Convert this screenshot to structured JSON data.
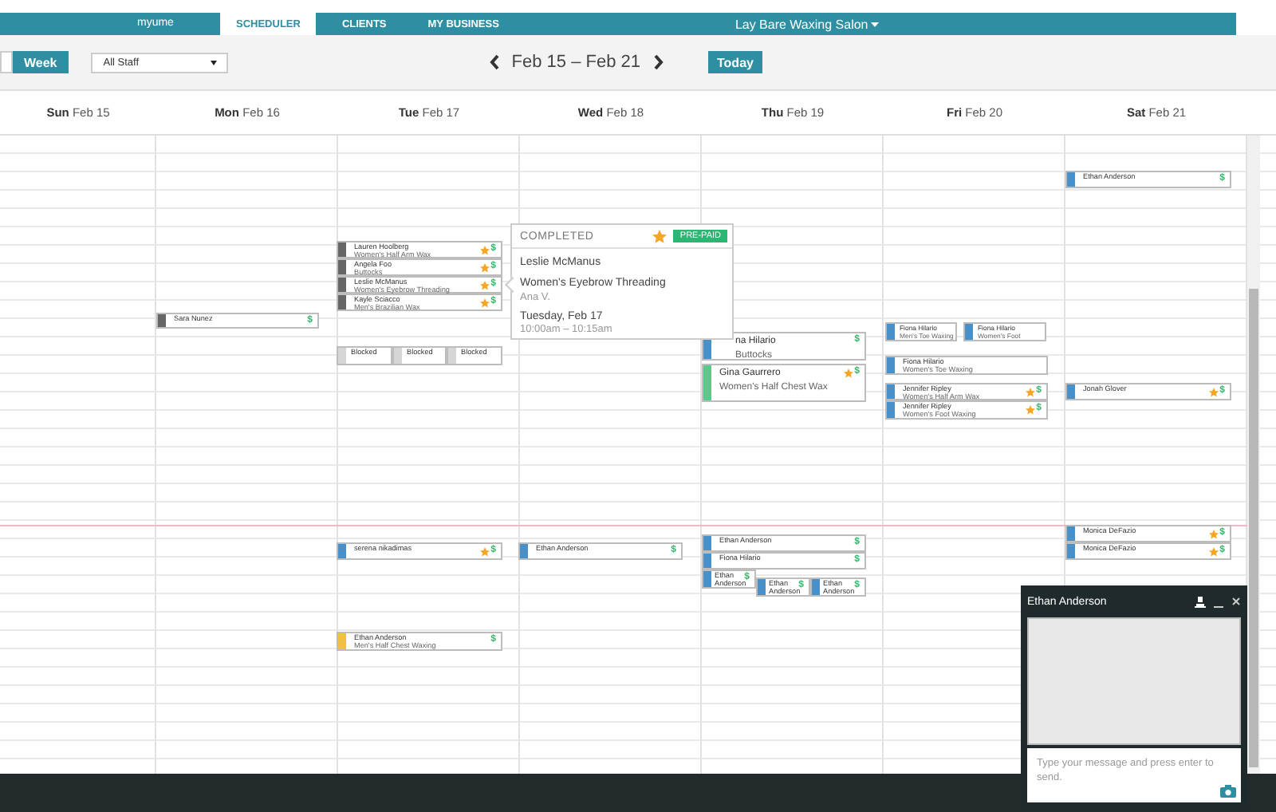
{
  "top_bar": {
    "logo": "myume",
    "tabs": [
      {
        "label": "SCHEDULER",
        "selected": true
      },
      {
        "label": "CLIENTS",
        "selected": false
      },
      {
        "label": "MY BUSINESS",
        "selected": false
      }
    ],
    "salon": "Lay Bare Waxing Salon"
  },
  "toolbar": {
    "view_button": "Week",
    "staff_select": "All Staff",
    "date_range": "Feb 15 – Feb 21",
    "today_button": "Today"
  },
  "days": [
    {
      "header": "**Sun** Feb 15"
    },
    {
      "header": "**Mon** Feb 16",
      "appointments": [
        {
          "kind": "appointment",
          "client": "Sara Nunez",
          "color": "#666666",
          "starred": false,
          "badge": "$"
        }
      ]
    },
    {
      "header": "**Tue** Feb 17",
      "appointments": [
        {
          "kind": "appointment",
          "client": "Lauren Hoolberg",
          "service": "Women's Half Arm Wax",
          "color": "#666666",
          "starred": true,
          "badge": "$"
        },
        {
          "kind": "appointment",
          "client": "Angela Foo",
          "service": "Buttocks",
          "color": "#666666",
          "starred": true,
          "badge": "$"
        },
        {
          "kind": "appointment",
          "client": "Leslie McManus",
          "service": "Women's Eyebrow Threading",
          "color": "#666666",
          "starred": true,
          "badge": "$"
        },
        {
          "kind": "appointment",
          "client": "Kayle Sciacco",
          "service": "Men's Brazilian Wax",
          "color": "#666666",
          "starred": true,
          "badge": "$"
        },
        {
          "kind": "blocked",
          "client": "Blocked"
        },
        {
          "kind": "blocked",
          "client": "Blocked"
        },
        {
          "kind": "blocked",
          "client": "Blocked"
        },
        {
          "kind": "appointment",
          "client": "serena nikadimas",
          "color": "#4a90c8",
          "starred": true,
          "badge": "$"
        },
        {
          "kind": "appointment",
          "client": "Ethan Anderson",
          "service": "Men's Half Chest Waxing",
          "color": "#f0c040",
          "starred": false,
          "badge": "$"
        }
      ]
    },
    {
      "header": "**Wed** Feb 18",
      "appointments": [
        {
          "kind": "appointment",
          "client": "Ethan Anderson",
          "color": "#4a90c8",
          "starred": false,
          "badge": "$"
        }
      ]
    },
    {
      "header": "**Thu** Feb 19",
      "appointments": [
        {
          "kind": "appointment",
          "client": "na Hilario",
          "service": "Buttocks",
          "color": "#4a90c8",
          "starred": false,
          "badge": "$"
        },
        {
          "kind": "appointment",
          "client": "Gina Gaurrero",
          "service": "Women's Half Chest Wax",
          "color": "#5bc98a",
          "starred": true,
          "badge": "$"
        },
        {
          "kind": "appointment",
          "client": "Ethan Anderson",
          "color": "#4a90c8",
          "starred": false,
          "badge": "$"
        },
        {
          "kind": "appointment",
          "client": "Fiona Hilario",
          "color": "#4a90c8",
          "starred": false,
          "badge": "$"
        },
        {
          "kind": "appointment",
          "client": "Ethan Anderson",
          "color": "#4a90c8",
          "starred": false,
          "badge": "$"
        },
        {
          "kind": "appointment",
          "client": "Ethan Anderson",
          "color": "#4a90c8",
          "starred": false,
          "badge": "$"
        },
        {
          "kind": "appointment",
          "client": "Ethan Anderson",
          "color": "#4a90c8",
          "starred": false,
          "badge": "$"
        }
      ]
    },
    {
      "header": "**Fri** Feb 20",
      "appointments": [
        {
          "kind": "appointment",
          "client": "Fiona Hilario",
          "service": "Men's Toe Waxing",
          "color": "#4a90c8",
          "starred": false
        },
        {
          "kind": "appointment",
          "client": "Fiona Hilario",
          "service": "Women's Foot",
          "color": "#4a90c8",
          "starred": false
        },
        {
          "kind": "appointment",
          "client": "Fiona Hilario",
          "service": "Women's Toe Waxing",
          "color": "#4a90c8",
          "starred": false
        },
        {
          "kind": "appointment",
          "client": "Jennifer Ripley",
          "service": "Women's Half Arm Wax",
          "color": "#4a90c8",
          "starred": true,
          "badge": "$"
        },
        {
          "kind": "appointment",
          "client": "Jennifer Ripley",
          "service": "Women's Foot Waxing",
          "color": "#4a90c8",
          "starred": true,
          "badge": "$"
        }
      ]
    },
    {
      "header": "**Sat** Feb 21",
      "appointments": [
        {
          "kind": "appointment",
          "client": "Ethan Anderson",
          "color": "#4a90c8",
          "starred": false,
          "badge": "$"
        },
        {
          "kind": "appointment",
          "client": "Jonah Glover",
          "color": "#4a90c8",
          "starred": true,
          "badge": "$"
        },
        {
          "kind": "appointment",
          "client": "Monica DeFazio",
          "color": "#4a90c8",
          "starred": true,
          "badge": "$"
        },
        {
          "kind": "appointment",
          "client": "Monica DeFazio",
          "color": "#4a90c8",
          "starred": true,
          "badge": "$"
        }
      ]
    }
  ],
  "popup": {
    "status": "COMPLETED",
    "starred": true,
    "badge": "PRE-PAID",
    "client": "Leslie McManus",
    "service": "Women's Eyebrow Threading",
    "staff": "Ana V.",
    "date": "Tuesday, Feb 17",
    "time": "10:00am – 10:15am"
  },
  "chat": {
    "title": "Ethan Anderson",
    "placeholder": "Type your message and press enter to send."
  }
}
